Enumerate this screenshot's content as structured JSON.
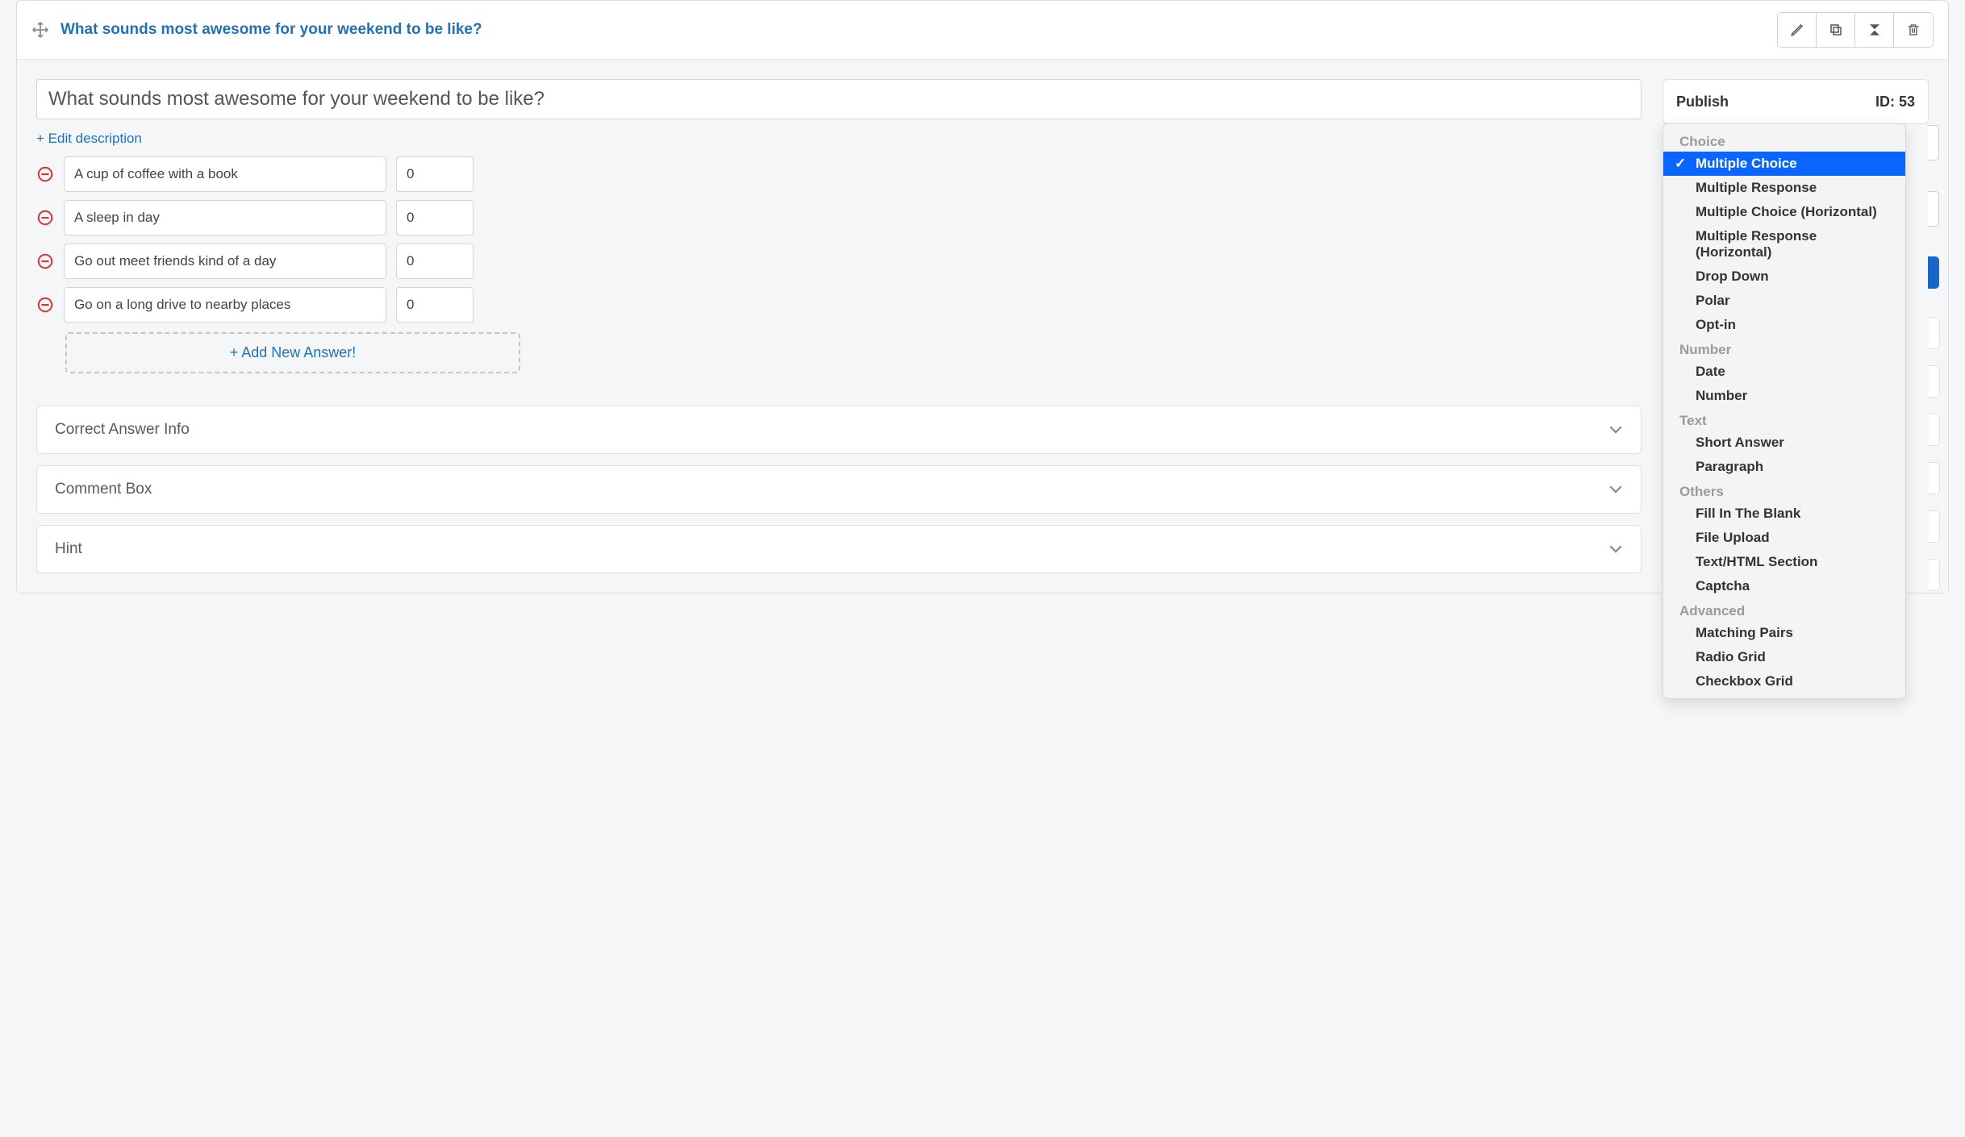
{
  "header": {
    "title": "What sounds most awesome for your weekend to be like?"
  },
  "question": {
    "title": "What sounds most awesome for your weekend to be like?",
    "edit_description_label": "+ Edit description",
    "answers": [
      {
        "text": "A cup of coffee with a book",
        "points": "0"
      },
      {
        "text": "A sleep in day",
        "points": "0"
      },
      {
        "text": "Go out meet friends kind of a day",
        "points": "0"
      },
      {
        "text": "Go on a long drive to nearby places",
        "points": "0"
      }
    ],
    "add_answer_label": "+ Add New Answer!"
  },
  "accordions": {
    "correct_answer_info": "Correct Answer Info",
    "comment_box": "Comment Box",
    "hint": "Hint"
  },
  "sidebar": {
    "publish_label": "Publish",
    "id_label": "ID: 53"
  },
  "dropdown": {
    "selected": "Multiple Choice",
    "groups": [
      {
        "label": "Choice",
        "items": [
          "Multiple Choice",
          "Multiple Response",
          "Multiple Choice (Horizontal)",
          "Multiple Response (Horizontal)",
          "Drop Down",
          "Polar",
          "Opt-in"
        ]
      },
      {
        "label": "Number",
        "items": [
          "Date",
          "Number"
        ]
      },
      {
        "label": "Text",
        "items": [
          "Short Answer",
          "Paragraph"
        ]
      },
      {
        "label": "Others",
        "items": [
          "Fill In The Blank",
          "File Upload",
          "Text/HTML Section",
          "Captcha"
        ]
      },
      {
        "label": "Advanced",
        "items": [
          "Matching Pairs",
          "Radio Grid",
          "Checkbox Grid"
        ]
      }
    ]
  }
}
